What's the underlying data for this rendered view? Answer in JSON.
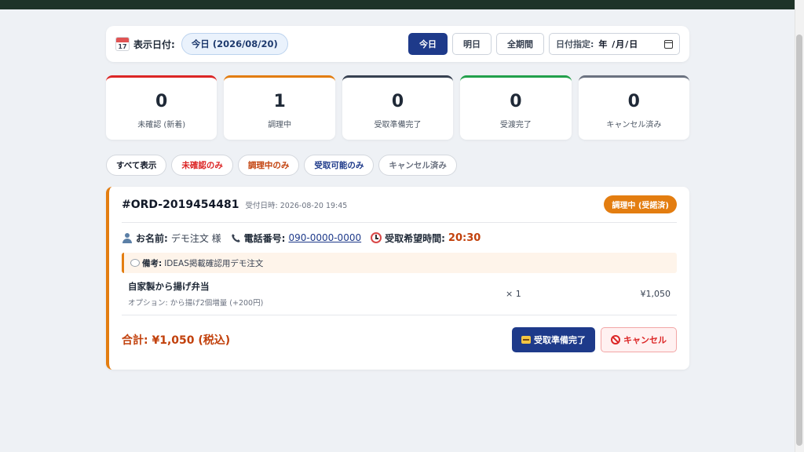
{
  "date_bar": {
    "calendar_day": "17",
    "label": "表示日付:",
    "current": "今日 (2026/08/20)",
    "buttons": [
      "今日",
      "明日",
      "全期間"
    ],
    "picker_label": "日付指定:",
    "picker_value": "年 /月/日"
  },
  "stats": [
    {
      "count": "0",
      "label": "未確認 (新着)",
      "color": "#dc2626"
    },
    {
      "count": "1",
      "label": "調理中",
      "color": "#e37d10"
    },
    {
      "count": "0",
      "label": "受取準備完了",
      "color": "#374151"
    },
    {
      "count": "0",
      "label": "受渡完了",
      "color": "#22a04b"
    },
    {
      "count": "0",
      "label": "キャンセル済み",
      "color": "#6b7280"
    }
  ],
  "filters": [
    {
      "label": "すべて表示",
      "color": "#111827"
    },
    {
      "label": "未確認のみ",
      "color": "#dc2626"
    },
    {
      "label": "調理中のみ",
      "color": "#c2410c"
    },
    {
      "label": "受取可能のみ",
      "color": "#1e3a8a"
    },
    {
      "label": "キャンセル済み",
      "color": "#6b7280"
    }
  ],
  "order": {
    "id": "#ORD-2019454481",
    "received": "受付日時: 2026-08-20 19:45",
    "status": "調理中 (受諾済)",
    "name_label": "お名前:",
    "name": "デモ注文 様",
    "phone_label": "電話番号:",
    "phone": "090-0000-0000",
    "pickup_label": "受取希望時間:",
    "pickup": "20:30",
    "note_label": "備考:",
    "note": "IDEAS掲載確認用デモ注文",
    "item": {
      "name": "自家製から揚げ弁当",
      "option": "オプション: から揚げ2個増量 (+200円)",
      "qty": "× 1",
      "price": "¥1,050"
    },
    "total": "合計: ¥1,050 (税込)",
    "ready_button": "受取準備完了",
    "cancel_button": "キャンセル"
  }
}
